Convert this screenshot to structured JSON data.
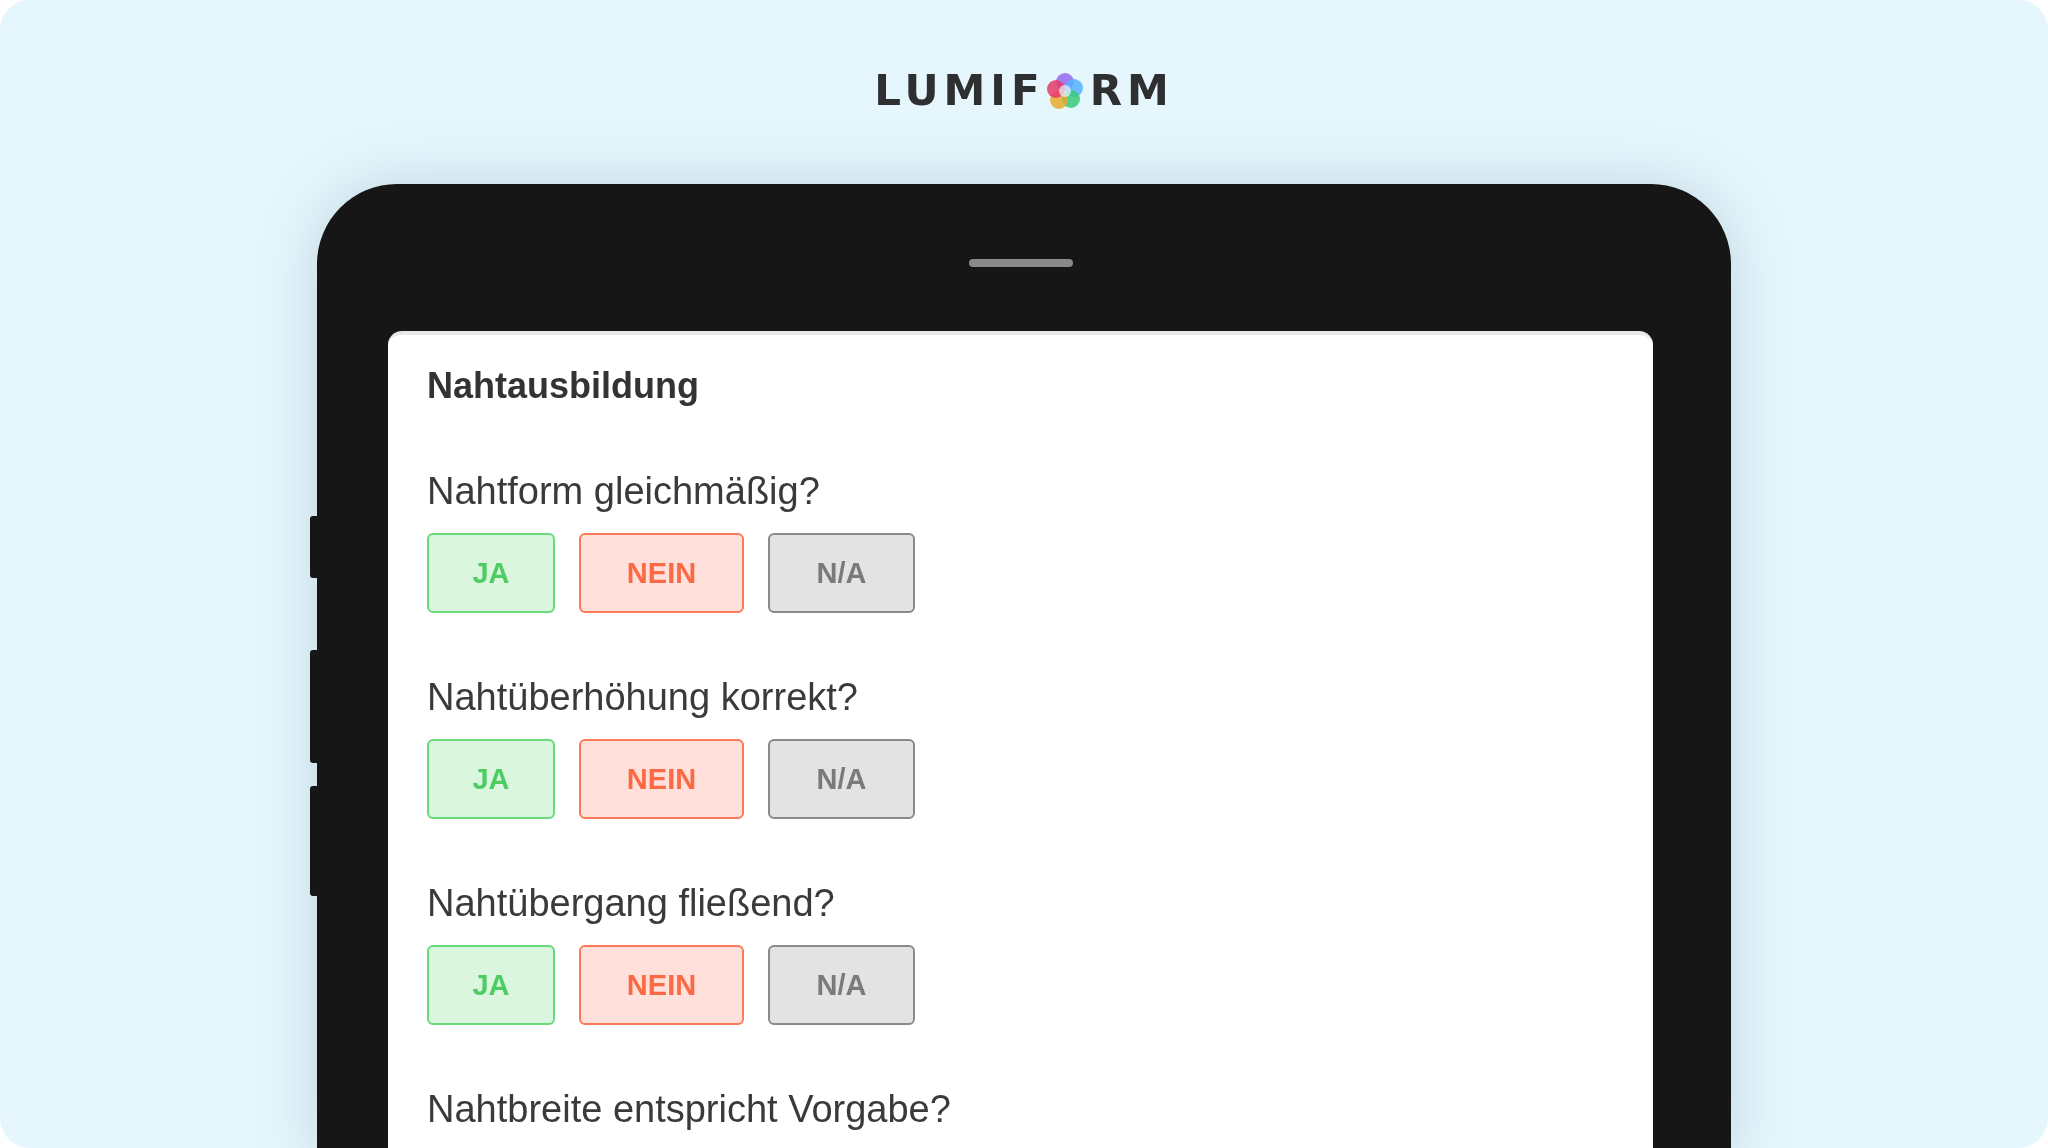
{
  "logo": {
    "before": "LUMIF",
    "after": "RM"
  },
  "form": {
    "section_title": "Nahtausbildung",
    "questions": [
      {
        "text": "Nahtform gleichmäßig?",
        "options": [
          {
            "label": "JA",
            "kind": "yes"
          },
          {
            "label": "NEIN",
            "kind": "no"
          },
          {
            "label": "N/A",
            "kind": "na"
          }
        ]
      },
      {
        "text": "Nahtüberhöhung korrekt?",
        "options": [
          {
            "label": "JA",
            "kind": "yes"
          },
          {
            "label": "NEIN",
            "kind": "no"
          },
          {
            "label": "N/A",
            "kind": "na"
          }
        ]
      },
      {
        "text": "Nahtübergang fließend?",
        "options": [
          {
            "label": "JA",
            "kind": "yes"
          },
          {
            "label": "NEIN",
            "kind": "no"
          },
          {
            "label": "N/A",
            "kind": "na"
          }
        ]
      },
      {
        "text": "Nahtbreite entspricht Vorgabe?"
      }
    ]
  }
}
